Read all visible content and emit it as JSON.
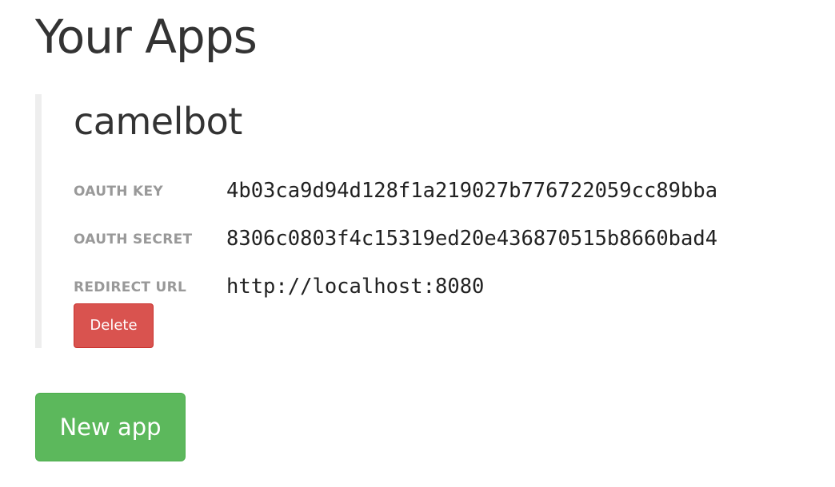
{
  "page": {
    "title": "Your Apps"
  },
  "apps": [
    {
      "name": "camelbot",
      "fields": {
        "oauth_key": {
          "label": "OAUTH KEY",
          "value": "4b03ca9d94d128f1a219027b776722059cc89bba"
        },
        "oauth_secret": {
          "label": "OAUTH SECRET",
          "value": "8306c0803f4c15319ed20e436870515b8660bad4"
        },
        "redirect_url": {
          "label": "REDIRECT URL",
          "value": "http://localhost:8080"
        }
      },
      "delete_label": "Delete"
    }
  ],
  "actions": {
    "new_app_label": "New app"
  },
  "colors": {
    "danger": "#d9534f",
    "success": "#5cb85c",
    "label_gray": "#999999",
    "card_border": "#eeeeee",
    "text": "#333333"
  }
}
